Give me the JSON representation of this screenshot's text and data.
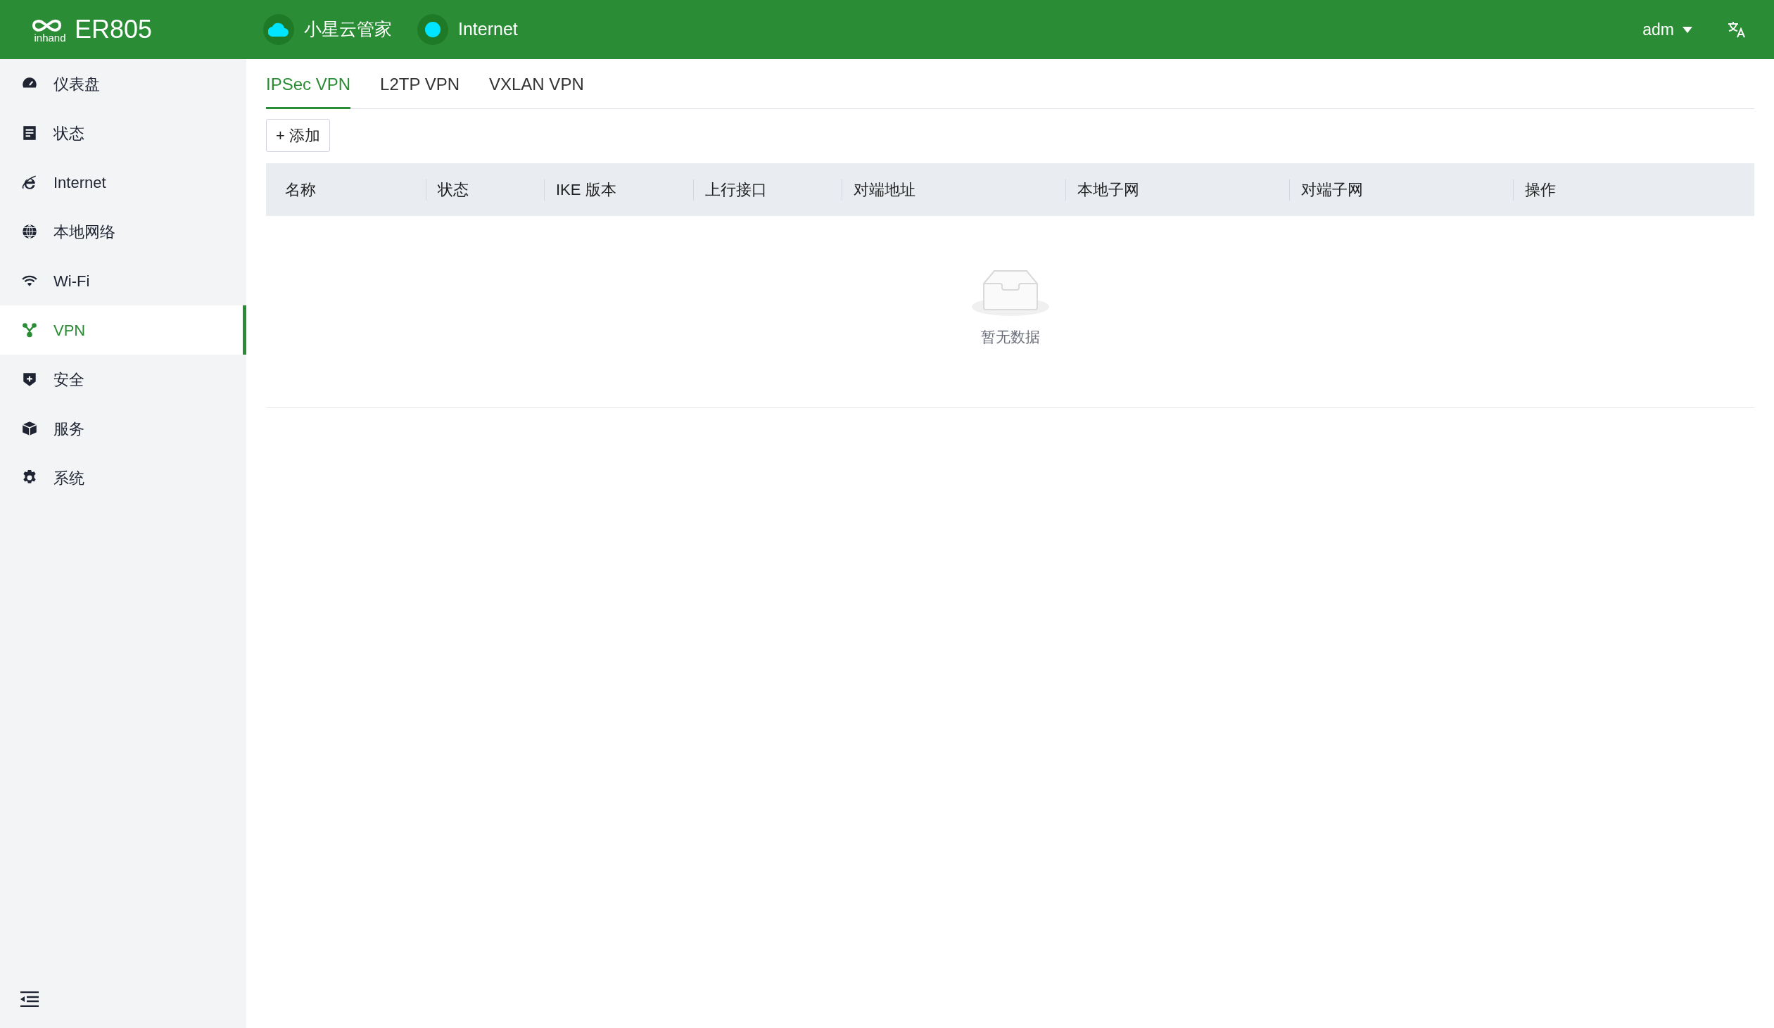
{
  "header": {
    "logo_text": "inhand",
    "product": "ER805",
    "status_items": [
      {
        "kind": "cloud",
        "label": "小星云管家",
        "color": "#00e5ff"
      },
      {
        "kind": "dot",
        "label": "Internet",
        "color": "#00e5ff"
      }
    ],
    "user": "adm"
  },
  "sidebar": {
    "items": [
      {
        "label": "仪表盘",
        "selected": false
      },
      {
        "label": "状态",
        "selected": false
      },
      {
        "label": "Internet",
        "selected": false
      },
      {
        "label": "本地网络",
        "selected": false
      },
      {
        "label": "Wi-Fi",
        "selected": false
      },
      {
        "label": "VPN",
        "selected": true
      },
      {
        "label": "安全",
        "selected": false
      },
      {
        "label": "服务",
        "selected": false
      },
      {
        "label": "系统",
        "selected": false
      }
    ]
  },
  "tabs": [
    {
      "label": "IPSec VPN",
      "selected": true
    },
    {
      "label": "L2TP VPN",
      "selected": false
    },
    {
      "label": "VXLAN VPN",
      "selected": false
    }
  ],
  "add_button": "+ 添加",
  "table": {
    "columns": [
      "名称",
      "状态",
      "IKE 版本",
      "上行接口",
      "对端地址",
      "本地子网",
      "对端子网",
      "操作"
    ],
    "empty_text": "暂无数据"
  }
}
